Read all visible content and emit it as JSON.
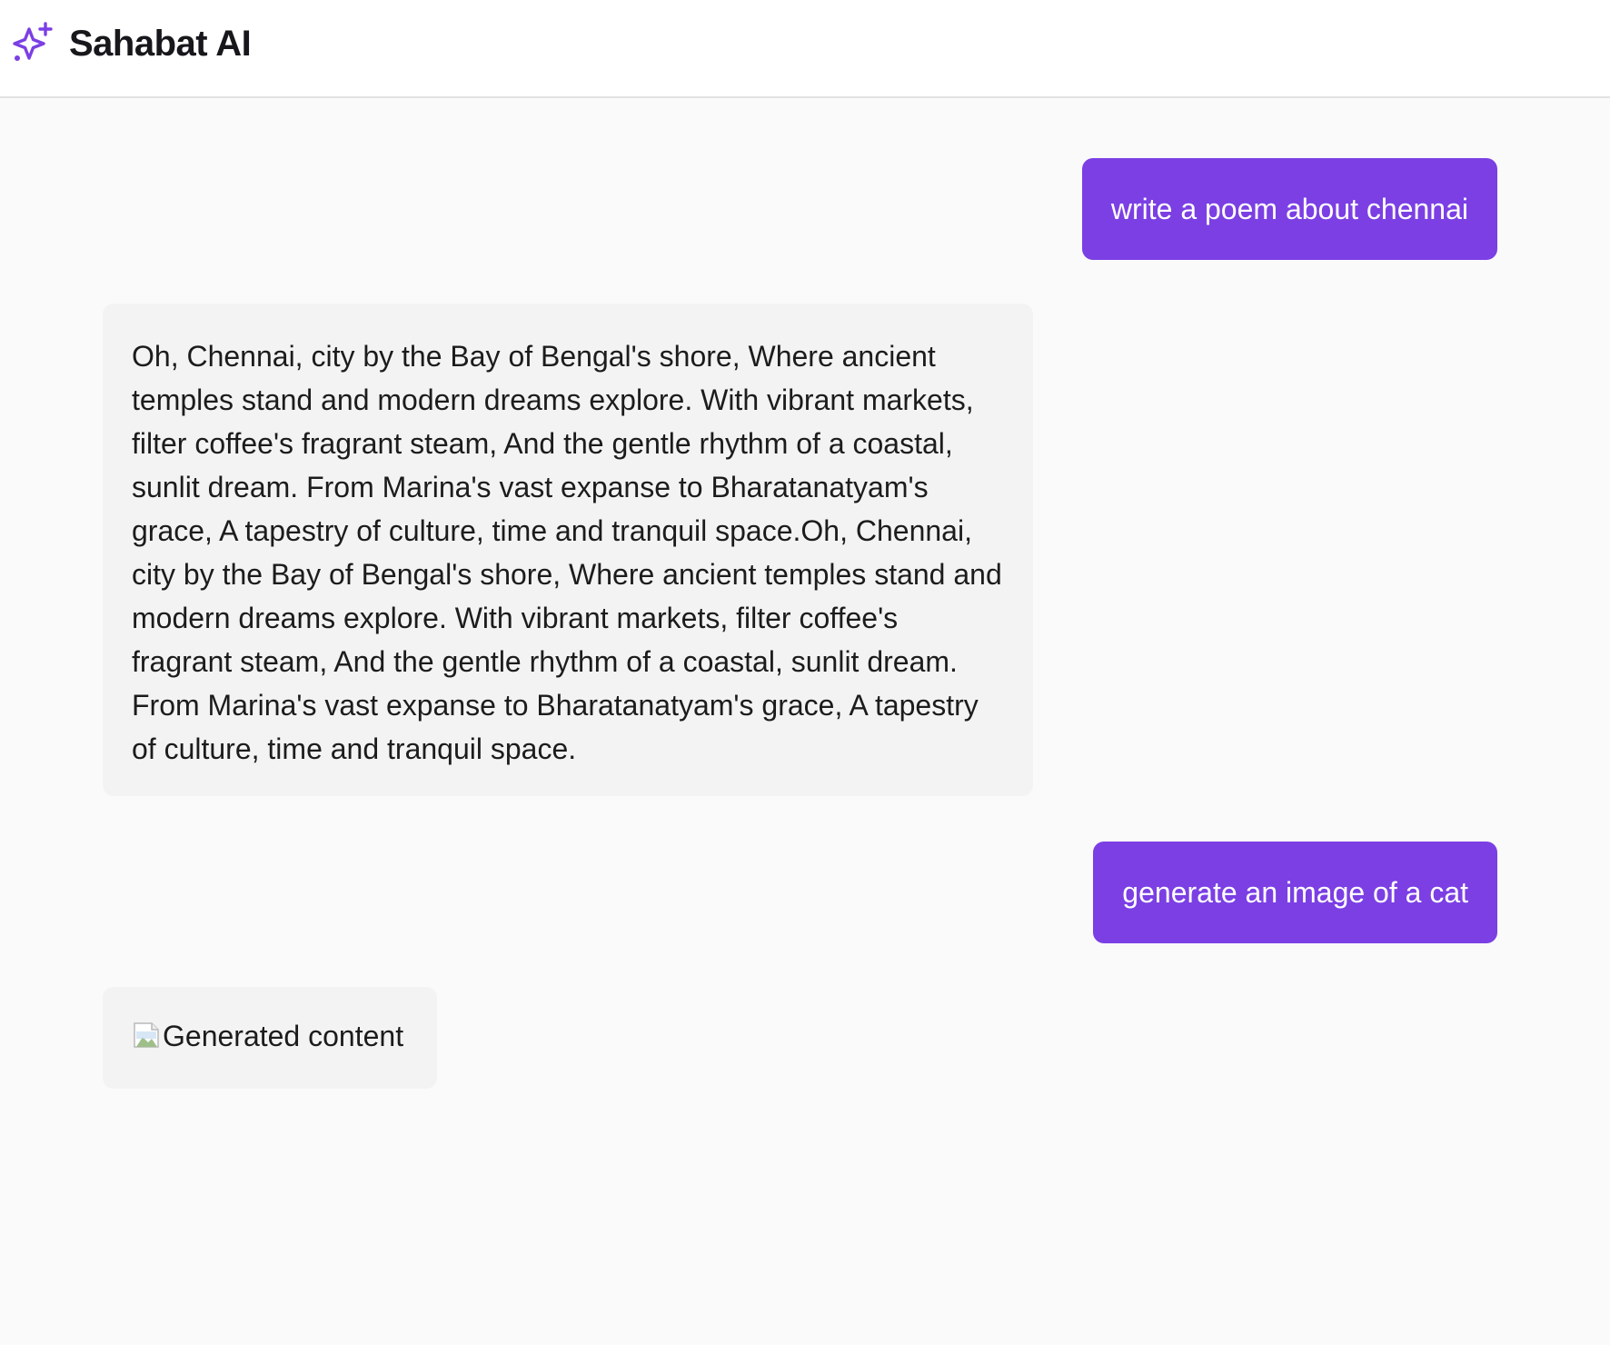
{
  "header": {
    "title": "Sahabat AI",
    "logo_icon": "sparkle-icon",
    "accent_color": "#7b3fe4"
  },
  "conversation": {
    "messages": [
      {
        "role": "user",
        "text": "write a poem about chennai"
      },
      {
        "role": "assistant",
        "text": "Oh, Chennai, city by the Bay of Bengal's shore, Where ancient temples stand and modern dreams explore. With vibrant markets, filter coffee's fragrant steam, And the gentle rhythm of a coastal, sunlit dream. From Marina's vast expanse to Bharatanatyam's grace, A tapestry of culture, time and tranquil space.Oh, Chennai, city by the Bay of Bengal's shore, Where ancient temples stand and modern dreams explore. With vibrant markets, filter coffee's fragrant steam, And the gentle rhythm of a coastal, sunlit dream. From Marina's vast expanse to Bharatanatyam's grace, A tapestry of culture, time and tranquil space."
      },
      {
        "role": "user",
        "text": "generate an image of a cat"
      },
      {
        "role": "assistant",
        "image_alt": "Generated content",
        "image_icon": "broken-image-icon"
      }
    ]
  }
}
